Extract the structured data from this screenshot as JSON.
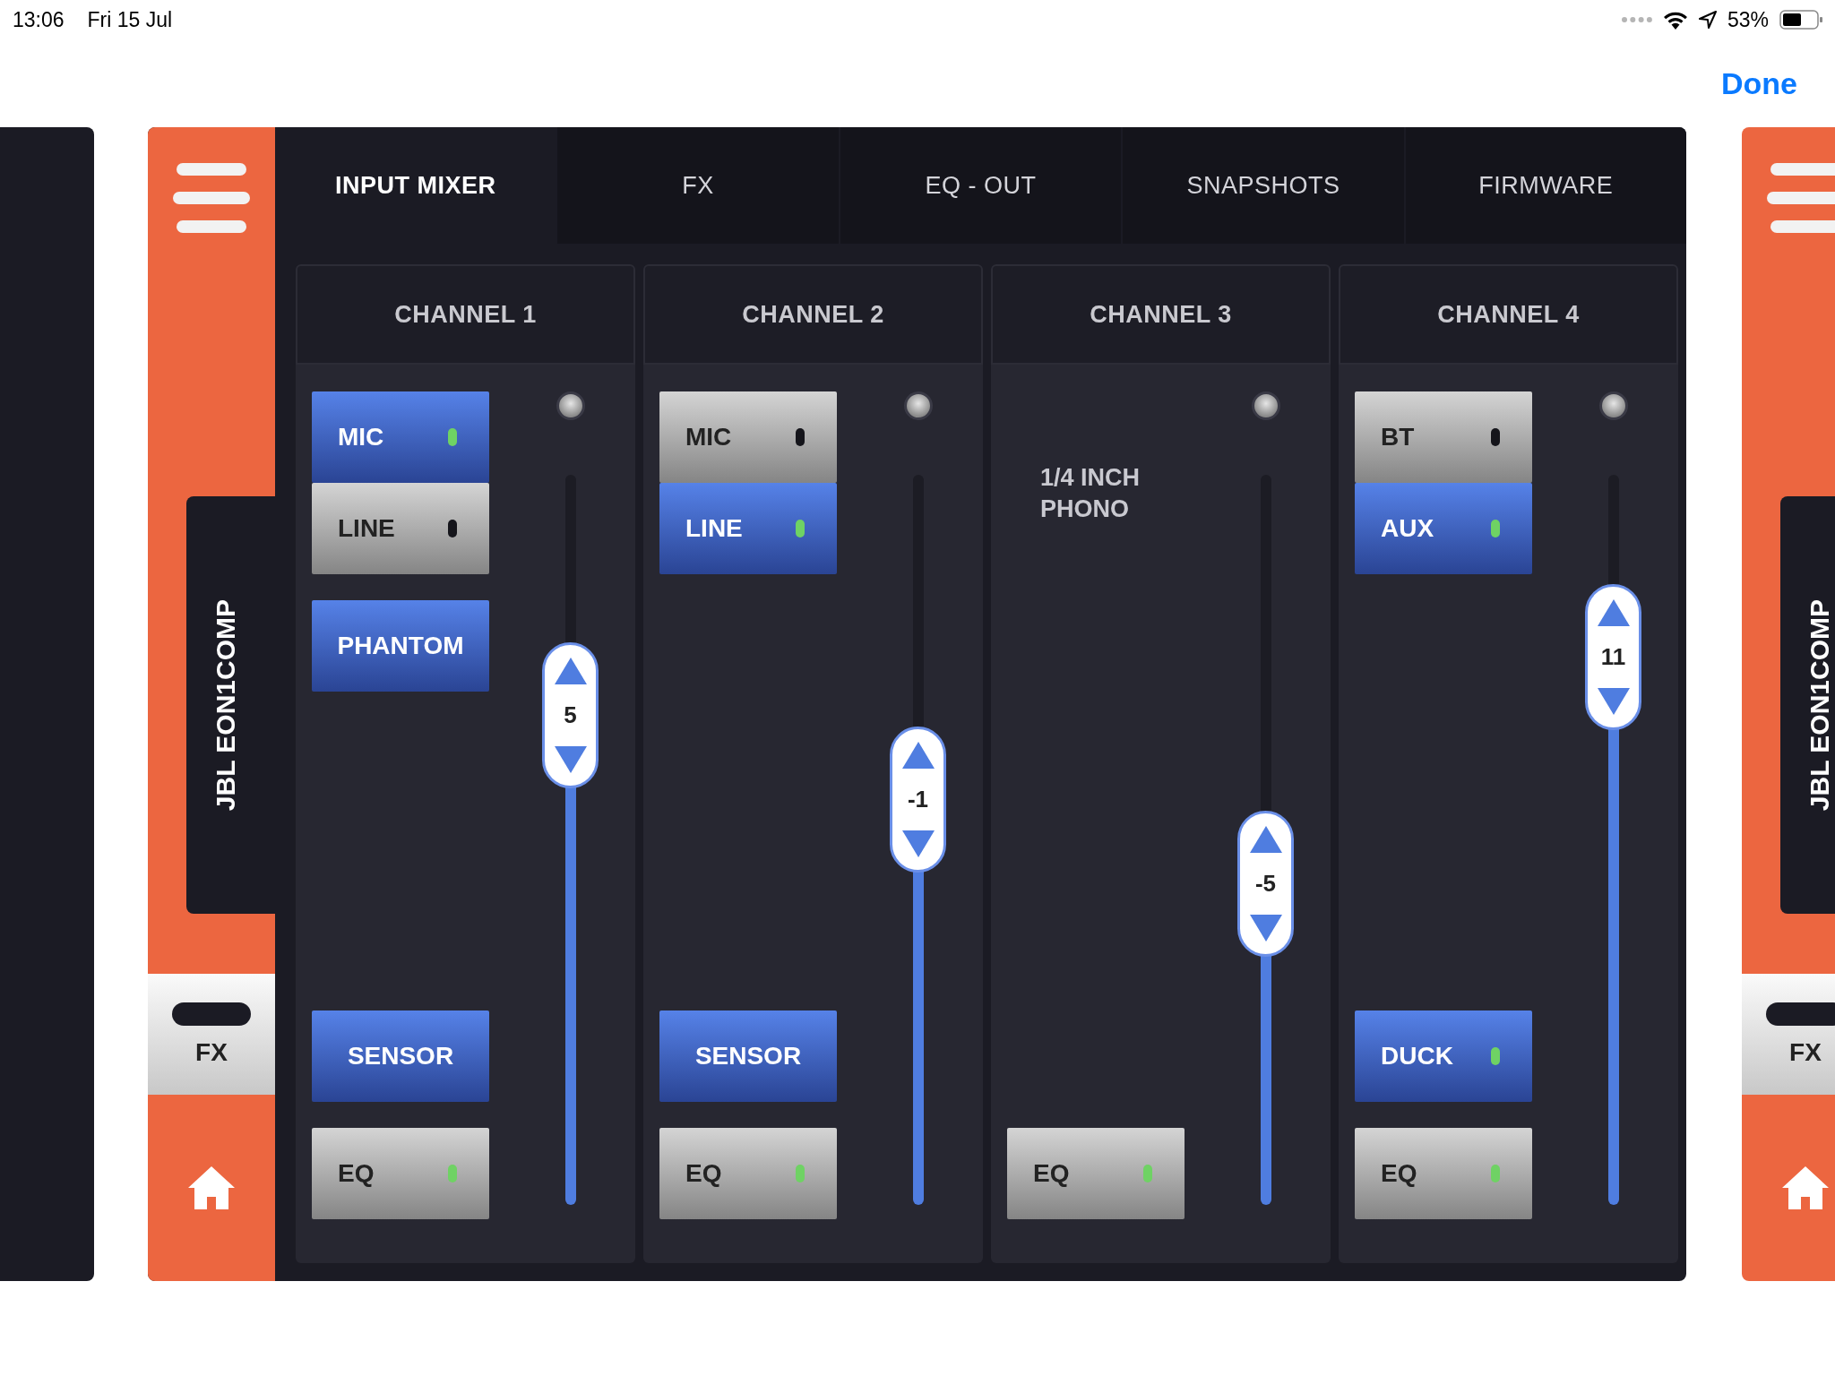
{
  "status_bar": {
    "time": "13:06",
    "date": "Fri 15 Jul",
    "battery": "53%"
  },
  "nav": {
    "done": "Done"
  },
  "main_card": {
    "sidebar": {
      "name": "JBL EON1COMP",
      "fx": "FX"
    },
    "tabs": [
      {
        "label": "INPUT MIXER",
        "selected": true
      },
      {
        "label": "FX",
        "selected": false
      },
      {
        "label": "EQ - OUT",
        "selected": false
      },
      {
        "label": "SNAPSHOTS",
        "selected": false
      },
      {
        "label": "FIRMWARE",
        "selected": false
      }
    ],
    "channels": [
      {
        "name": "CHANNEL 1",
        "inputs": [
          {
            "label": "MIC",
            "kind": "led",
            "on": true,
            "lit": true
          },
          {
            "label": "LINE",
            "kind": "led",
            "on": false,
            "lit": false
          }
        ],
        "extras": [
          {
            "label": "PHANTOM",
            "kind": "plain",
            "on": true
          }
        ],
        "bottom": [
          {
            "label": "SENSOR",
            "kind": "plain",
            "on": true
          },
          {
            "label": "EQ",
            "kind": "led",
            "on": false,
            "lit": true
          }
        ],
        "fader": {
          "value": "5",
          "level": 0.67
        }
      },
      {
        "name": "CHANNEL 2",
        "inputs": [
          {
            "label": "MIC",
            "kind": "led",
            "on": false,
            "lit": false
          },
          {
            "label": "LINE",
            "kind": "led",
            "on": true,
            "lit": true
          }
        ],
        "bottom": [
          {
            "label": "SENSOR",
            "kind": "plain",
            "on": true
          },
          {
            "label": "EQ",
            "kind": "led",
            "on": false,
            "lit": true
          }
        ],
        "fader": {
          "value": "-1",
          "level": 0.555
        }
      },
      {
        "name": "CHANNEL 3",
        "source": "1/4 INCH PHONO",
        "bottom": [
          {
            "label": "EQ",
            "kind": "led",
            "on": false,
            "lit": true
          }
        ],
        "fader": {
          "value": "-5",
          "level": 0.44
        }
      },
      {
        "name": "CHANNEL 4",
        "inputs": [
          {
            "label": "BT",
            "kind": "led",
            "on": false,
            "lit": false
          },
          {
            "label": "AUX",
            "kind": "led",
            "on": true,
            "lit": true
          }
        ],
        "bottom": [
          {
            "label": "DUCK",
            "kind": "led",
            "on": true,
            "lit": true
          },
          {
            "label": "EQ",
            "kind": "led",
            "on": false,
            "lit": true
          }
        ],
        "fader": {
          "value": "11",
          "level": 0.75
        }
      }
    ]
  },
  "next_card": {
    "sidebar": {
      "name": "JBL EON1COMP",
      "fx": "FX"
    }
  }
}
